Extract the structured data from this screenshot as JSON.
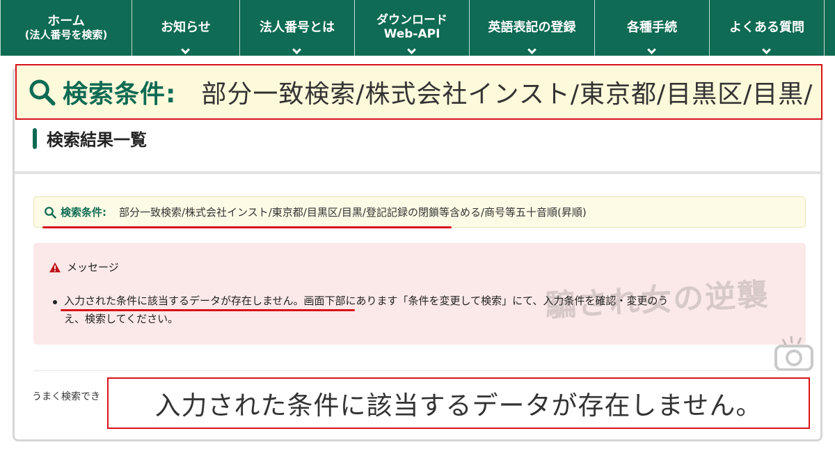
{
  "nav": {
    "items": [
      {
        "line1": "ホーム",
        "line2": "(法人番号を検索)"
      },
      {
        "line1": "お知らせ"
      },
      {
        "line1": "法人番号とは"
      },
      {
        "line1": "ダウンロード",
        "line2": "Web-API"
      },
      {
        "line1": "英語表記の登録"
      },
      {
        "line1": "各種手続"
      },
      {
        "line1": "よくある質問"
      }
    ]
  },
  "zoom_condition": {
    "label": "検索条件:",
    "value": "部分一致検索/株式会社インスト/東京都/目黒区/目黒/"
  },
  "results": {
    "heading": "検索結果一覧",
    "condition_label": "検索条件:",
    "condition_value": "部分一致検索/株式会社インスト/東京都/目黒区/目黒/登記記録の閉鎖等含める/商号等五十音順(昇順)"
  },
  "message": {
    "title": "メッセージ",
    "line1": "入力された条件に該当するデータが存在しません。画面下部にあります「条件を変更して検索」にて、入力条件を確認・変更のう",
    "line2": "え、検索してください。"
  },
  "watermark": "騙され女の逆襲",
  "footer_text": "うまく検索でき",
  "zoom_message": "入力された条件に該当するデータが存在しません。",
  "colors": {
    "brand_green": "#0f6b53",
    "highlight_red": "#d8121a",
    "condition_bg": "#fdfbe6",
    "message_bg": "#fbe8e8"
  }
}
